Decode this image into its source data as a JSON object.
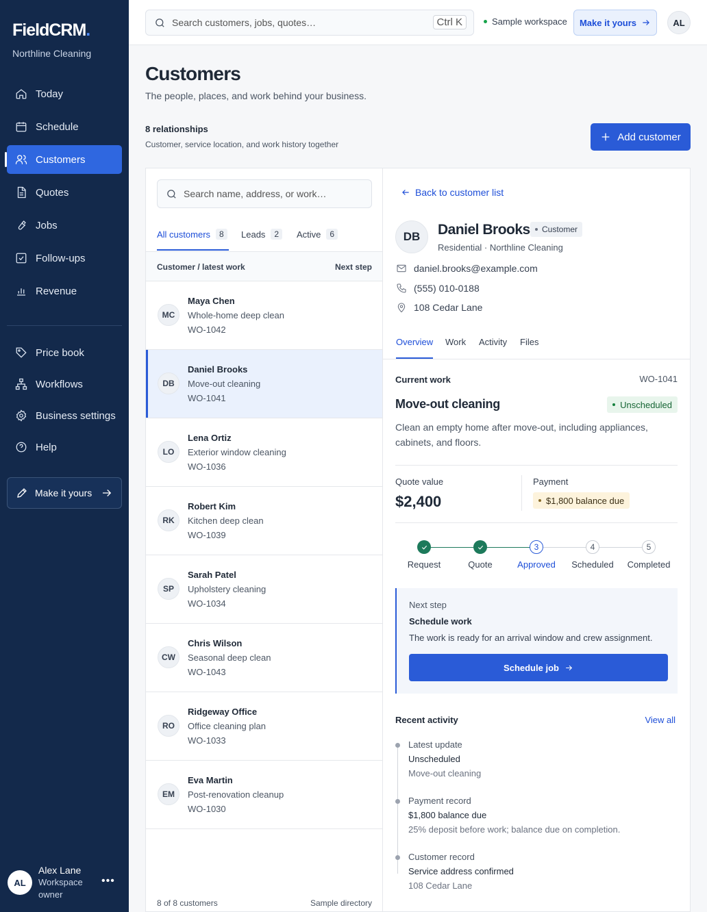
{
  "brand": {
    "name": "FieldCRM",
    "org": "Northline Cleaning"
  },
  "nav": {
    "primary": [
      {
        "label": "Today",
        "icon": "home-icon"
      },
      {
        "label": "Schedule",
        "icon": "calendar-icon"
      },
      {
        "label": "Customers",
        "icon": "users-icon",
        "active": true
      },
      {
        "label": "Quotes",
        "icon": "document-icon"
      },
      {
        "label": "Jobs",
        "icon": "wrench-icon"
      },
      {
        "label": "Follow-ups",
        "icon": "checkbox-icon"
      },
      {
        "label": "Revenue",
        "icon": "bar-chart-icon"
      }
    ],
    "secondary": [
      {
        "label": "Price book",
        "icon": "tag-icon"
      },
      {
        "label": "Workflows",
        "icon": "workflow-icon"
      },
      {
        "label": "Business settings",
        "icon": "gear-icon"
      },
      {
        "label": "Help",
        "icon": "help-icon"
      }
    ],
    "make_label": "Make it yours"
  },
  "user": {
    "initials": "AL",
    "name": "Alex Lane",
    "role": "Workspace owner"
  },
  "topbar": {
    "search_placeholder": "Search customers, jobs, quotes…",
    "shortcut": "Ctrl K",
    "workspace": "Sample workspace",
    "make_label": "Make it yours",
    "avatar": "AL"
  },
  "page": {
    "title": "Customers",
    "subtitle": "The people, places, and work behind your business.",
    "rel_count": "8 relationships",
    "rel_desc": "Customer, service location, and work history together",
    "add_label": "Add customer"
  },
  "list": {
    "search_placeholder": "Search name, address, or work…",
    "tabs": [
      {
        "label": "All customers",
        "count": "8"
      },
      {
        "label": "Leads",
        "count": "2"
      },
      {
        "label": "Active",
        "count": "6"
      }
    ],
    "head_left": "Customer / latest work",
    "head_right": "Next step",
    "rows": [
      {
        "initials": "MC",
        "name": "Maya Chen",
        "work": "Whole-home deep clean",
        "wo": "WO-1042"
      },
      {
        "initials": "DB",
        "name": "Daniel Brooks",
        "work": "Move-out cleaning",
        "wo": "WO-1041"
      },
      {
        "initials": "LO",
        "name": "Lena Ortiz",
        "work": "Exterior window cleaning",
        "wo": "WO-1036"
      },
      {
        "initials": "RK",
        "name": "Robert Kim",
        "work": "Kitchen deep clean",
        "wo": "WO-1039"
      },
      {
        "initials": "SP",
        "name": "Sarah Patel",
        "work": "Upholstery cleaning",
        "wo": "WO-1034"
      },
      {
        "initials": "CW",
        "name": "Chris Wilson",
        "work": "Seasonal deep clean",
        "wo": "WO-1043"
      },
      {
        "initials": "RO",
        "name": "Ridgeway Office",
        "work": "Office cleaning plan",
        "wo": "WO-1033"
      },
      {
        "initials": "EM",
        "name": "Eva Martin",
        "work": "Post-renovation cleanup",
        "wo": "WO-1030"
      }
    ],
    "footer_left": "8 of 8 customers",
    "footer_right": "Sample directory"
  },
  "detail": {
    "back_label": "Back to customer list",
    "initials": "DB",
    "name": "Daniel Brooks",
    "badge": "Customer",
    "sub": "Residential · Northline Cleaning",
    "email": "daniel.brooks@example.com",
    "phone": "(555) 010-0188",
    "address": "108 Cedar Lane",
    "tabs": [
      "Overview",
      "Work",
      "Activity",
      "Files"
    ],
    "current_label": "Current work",
    "wo": "WO-1041",
    "work_title": "Move-out cleaning",
    "status": "Unscheduled",
    "description": "Clean an empty home after move-out, including appliances, cabinets, and floors.",
    "quote_label": "Quote value",
    "quote_value": "$2,400",
    "payment_label": "Payment",
    "payment_badge": "$1,800 balance due",
    "steps": [
      {
        "n": "1",
        "label": "Request"
      },
      {
        "n": "2",
        "label": "Quote"
      },
      {
        "n": "3",
        "label": "Approved"
      },
      {
        "n": "4",
        "label": "Scheduled"
      },
      {
        "n": "5",
        "label": "Completed"
      }
    ],
    "next": {
      "label": "Next step",
      "title": "Schedule work",
      "desc": "The work is ready for an arrival window and crew assignment.",
      "button": "Schedule job"
    },
    "activity_title": "Recent activity",
    "view_all": "View all",
    "activity": [
      {
        "a": "Latest update",
        "b": "Unscheduled",
        "c": "Move-out cleaning"
      },
      {
        "a": "Payment record",
        "b": "$1,800 balance due",
        "c": "25% deposit before work; balance due on completion."
      },
      {
        "a": "Customer record",
        "b": "Service address confirmed",
        "c": "108 Cedar Lane"
      }
    ]
  }
}
